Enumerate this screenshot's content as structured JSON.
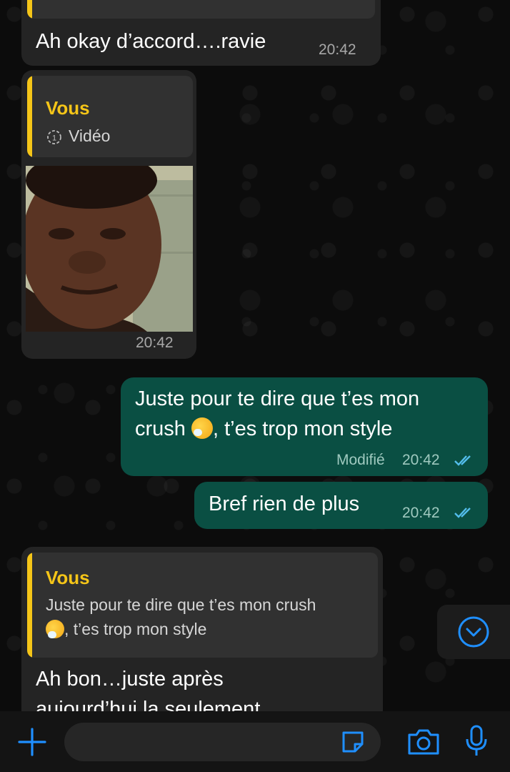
{
  "messages": [
    {
      "id": "m1",
      "direction": "in",
      "text": "Ah okay d’accord….ravie",
      "time": "20:42"
    },
    {
      "id": "m2",
      "direction": "in",
      "quote": {
        "author": "Vous",
        "text": "Vidéo"
      },
      "time": "20:42"
    },
    {
      "id": "m3",
      "direction": "out",
      "line1": "Juste pour te dire que t’es mon",
      "line2_pre": "crush ",
      "line2_post": ", t’es trop mon style",
      "edited_label": "Modifié",
      "time": "20:42",
      "status": "read"
    },
    {
      "id": "m4",
      "direction": "out",
      "text": "Bref rien de plus",
      "time": "20:42",
      "status": "read"
    },
    {
      "id": "m5",
      "direction": "in",
      "quote": {
        "author": "Vous",
        "line1": "Juste pour te dire que t’es mon crush",
        "line2": ", t’es trop mon style"
      },
      "line1": "Ah bon…juste après",
      "line2": "aujourd’hui la seulement"
    }
  ],
  "composer": {
    "placeholder": ""
  },
  "icons": {
    "add": "plus-icon",
    "sticker": "sticker-icon",
    "camera": "camera-icon",
    "mic": "microphone-icon",
    "scroll": "chevron-down-icon",
    "view_once": "view-once-icon",
    "ticks": "double-check-icon",
    "emoji": "sneezing-face-emoji"
  },
  "colors": {
    "accent_blue": "#1f8fff",
    "quote_author": "#f5c518",
    "out_bubble": "#0a4f43",
    "in_bubble": "#242424",
    "read_ticks": "#53bdeb"
  }
}
